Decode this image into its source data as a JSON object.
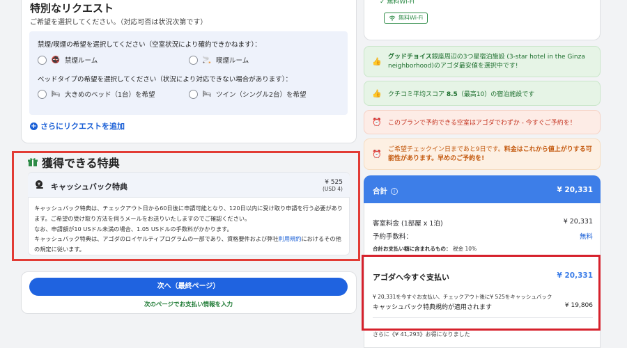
{
  "special_requests": {
    "title": "特別なリクエスト",
    "subtitle": "ご希望を選択してください。（対応可否は状況次第です）",
    "smoking_question": "禁煙/喫煙の希望を選択してください（空室状況により確約できかねます）：",
    "smoking_options": [
      "禁煙ルーム",
      "喫煙ルーム"
    ],
    "bed_question": "ベッドタイプの希望を選択してください（状況により対応できない場合があります）：",
    "bed_options": [
      "大きめのベッド（1台）を希望",
      "ツイン（シングル2台）を希望"
    ],
    "add_more": "さらにリクエストを追加"
  },
  "benefits": {
    "title": "獲得できる特典",
    "cashback_name": "キャッシュバック特典",
    "cashback_amount": "¥ 525",
    "cashback_usd": "(USD 4)",
    "body_line1": "キャッシュバック特典は、チェックアウト日から60日後に申請可能となり、120日以内に受け取り申請を行う必要があります。ご希望の受け取り方法を伺うメールをお送りいたしますのでご確認ください。",
    "body_line2": "なお、申請額が10 USドル未満の場合、1.05 USドルの手数料がかかります。",
    "body_line3a": "キャッシュバック特典は、アゴダのロイヤルティプログラムの一部であり、資格要件および弊社",
    "body_link": "利用規約",
    "body_line3b": "におけるその他の規定に従います。"
  },
  "next": {
    "button": "次へ（最終ページ）",
    "note": "次のページでお支払い情報を入力"
  },
  "amenities": {
    "top": "無料Wi-Fi",
    "wifi_tag": "無料Wi-Fi"
  },
  "alerts": {
    "good_choice_bold": "グッドチョイス",
    "good_choice_text": "銀座周辺の3つ星宿泊施設 (3-star hotel in the Ginza neighborhood)のアゴダ最安値を選択中です!",
    "review_text_a": "クチコミ平均スコア ",
    "review_score": "8.5",
    "review_text_b": "（最高10）の宿泊施設です",
    "last_room": "このプランで予約できる空室はアゴダでわずか - 今すぐご予約を！",
    "price_warn_a": "ご希望チェックイン日まであと9日です。",
    "price_warn_b": "料金はこれから値上がりする可能性があります。早めのご予約を!"
  },
  "summary": {
    "total_label": "合計",
    "total_value": "¥ 20,331",
    "room_rate_label": "客室料金 (1部屋 x 1泊)",
    "room_rate_value": "¥ 20,331",
    "fee_label": "予約手数料：",
    "fee_value": "無料",
    "tax_label": "合計お支払い額に含まれるもの：",
    "tax_value": "税金 10%",
    "pay_now_label": "アゴダへ今すぐ支払い",
    "pay_now_value": "¥ 20,331",
    "pay_note": "¥ 20,331を今すぐお支払い、チェックアウト後に¥ 525をキャッシュバック",
    "cashback_terms": "キャッシュバック特典規約が適用されます",
    "cashback_terms_value": "¥ 19,806",
    "savings": "さらに《¥ 41,293》お得になりました"
  }
}
